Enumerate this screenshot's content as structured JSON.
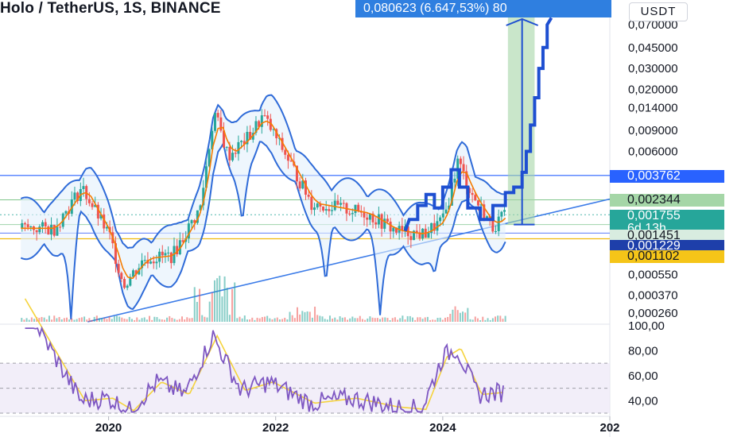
{
  "header": {
    "title": "Holo / TetherUS, 1S, BINANCE",
    "price_tag": "0,080623 (6.647,53%) 80",
    "currency": "USDT"
  },
  "colors": {
    "background": "#ffffff",
    "blue_line": "#2962ff",
    "bollinger": "#2f6bd8",
    "ema": "#f57c00",
    "candle_up": "#26a69a",
    "candle_down": "#ef5350",
    "rsi_line": "#7e57c2",
    "rsi_ma": "#f5d33b",
    "rsi_band": "#ede7f6",
    "target_box": "#a5d6a7",
    "projection": "#1e4fd1",
    "trend_line": "#3b7be8",
    "level_yellow": "#f0b90b"
  },
  "price_axis": {
    "labels": [
      "0,070000",
      "0,045000",
      "0,030000",
      "0,020000",
      "0,014000",
      "0,009000",
      "0,006000",
      "0,000550",
      "0,000370",
      "0,000260"
    ]
  },
  "badges": [
    {
      "text": "0,003762",
      "color": "#2962ff",
      "sub": ""
    },
    {
      "text": "0,002344",
      "color": "#a5d6a7",
      "sub": ""
    },
    {
      "text": "0,001755",
      "color": "#26a69a",
      "sub": "6d 13h"
    },
    {
      "text": "0,001451",
      "color": "#d8ece0",
      "sub": ""
    },
    {
      "text": "0,001229",
      "color": "#1e3faa",
      "sub": ""
    },
    {
      "text": "0,001102",
      "color": "#f5c518",
      "sub": ""
    }
  ],
  "rsi_axis": {
    "labels": [
      "100,00",
      "80,00",
      "60,00",
      "40,00"
    ]
  },
  "time_axis": {
    "labels": [
      "2020",
      "2022",
      "2024",
      "202"
    ]
  },
  "chart_data": [
    {
      "type": "line",
      "series_kind": "candlestick price (approximate close)",
      "ylog": true,
      "x": [
        "2019-05",
        "2019-09",
        "2020-01",
        "2020-03",
        "2020-06",
        "2020-10",
        "2021-02",
        "2021-04",
        "2021-06",
        "2021-09",
        "2021-11",
        "2022-02",
        "2022-06",
        "2022-10",
        "2023-02",
        "2023-06",
        "2023-10",
        "2024-01",
        "2024-03",
        "2024-05",
        "2024-08",
        "2024-10"
      ],
      "series": [
        {
          "name": "",
          "values": [
            0.00135,
            0.003,
            0.00115,
            0.00045,
            0.00075,
            0.0008,
            0.002,
            0.013,
            0.0055,
            0.008,
            0.012,
            0.006,
            0.0022,
            0.002,
            0.0018,
            0.0013,
            0.0012,
            0.0016,
            0.005,
            0.0026,
            0.0014,
            0.0018
          ]
        }
      ],
      "levels": [
        0.003762,
        0.002344,
        0.001755,
        0.001451,
        0.001229,
        0.001102
      ],
      "projection_target": 0.080623
    },
    {
      "type": "line",
      "series_kind": "RSI",
      "ylim": [
        30,
        100
      ],
      "band": [
        30,
        70
      ],
      "x": [
        "2019-05",
        "2019-09",
        "2020-01",
        "2020-04",
        "2020-08",
        "2020-12",
        "2021-04",
        "2021-08",
        "2021-12",
        "2022-06",
        "2022-12",
        "2023-06",
        "2023-10",
        "2024-01",
        "2024-03",
        "2024-06",
        "2024-10"
      ],
      "series": [
        {
          "name": "",
          "values": [
            78,
            40,
            42,
            32,
            55,
            45,
            92,
            48,
            55,
            38,
            42,
            35,
            33,
            75,
            82,
            45,
            47
          ]
        }
      ]
    }
  ]
}
